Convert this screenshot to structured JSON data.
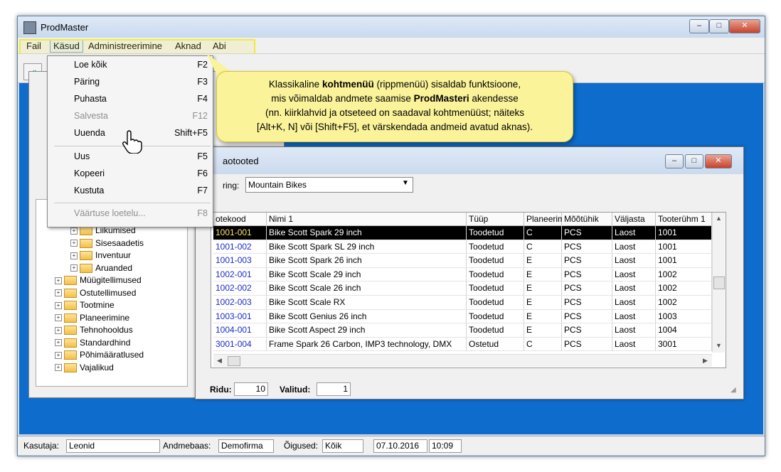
{
  "window": {
    "title": "ProdMaster",
    "controls": [
      "–",
      "□",
      "✕"
    ]
  },
  "menubar": {
    "items": [
      "Fail",
      "Käsud",
      "Administreerimine",
      "Aknad",
      "Abi"
    ]
  },
  "dropdown": {
    "items": [
      {
        "label": "Loe kõik",
        "key": "F2",
        "enabled": true
      },
      {
        "label": "Päring",
        "key": "F3",
        "enabled": true
      },
      {
        "label": "Puhasta",
        "key": "F4",
        "enabled": true
      },
      {
        "label": "Salvesta",
        "key": "F12",
        "enabled": false
      },
      {
        "label": "Uuenda",
        "key": "Shift+F5",
        "enabled": true
      },
      {
        "label": "Uus",
        "key": "F5",
        "enabled": true
      },
      {
        "label": "Kopeeri",
        "key": "F6",
        "enabled": true
      },
      {
        "label": "Kustuta",
        "key": "F7",
        "enabled": true
      },
      {
        "label": "Väärtuse loetelu...",
        "key": "F8",
        "enabled": false
      }
    ]
  },
  "callout": {
    "line1_pre": "Klassikaline ",
    "line1_bold": "kohtmenüü",
    "line1_post": " (rippmenüü) sisaldab funktsioone,",
    "line2_pre": "mis võimaldab andmete saamise ",
    "line2_bold": "ProdMasteri",
    "line2_post": " akendesse",
    "line3": "(nn. kiirklahvid ja otseteed on saadaval kohtmenüüst; näiteks",
    "line4": "[Alt+K, N] või [Shift+F5], et värskendada andmeid avatud aknas)."
  },
  "tree": {
    "items": [
      {
        "label": "Liikumised",
        "level": 1
      },
      {
        "label": "Sisesaadetis",
        "level": 1
      },
      {
        "label": "Inventuur",
        "level": 1
      },
      {
        "label": "Aruanded",
        "level": 1
      },
      {
        "label": "Müügitellimused",
        "level": 0
      },
      {
        "label": "Ostutellimused",
        "level": 0
      },
      {
        "label": "Tootmine",
        "level": 0
      },
      {
        "label": "Planeerimine",
        "level": 0
      },
      {
        "label": "Tehnohooldus",
        "level": 0
      },
      {
        "label": "Standardhind",
        "level": 0
      },
      {
        "label": "Põhimääratlused",
        "level": 0
      },
      {
        "label": "Vajalikud",
        "level": 0
      }
    ]
  },
  "products": {
    "title": "aotooted",
    "filter_label": "ring:",
    "filter_value": "Mountain Bikes",
    "columns": [
      "otekood",
      "Nimi 1",
      "Tüüp",
      "Planeerim",
      "Mõõtühik",
      "Väljasta",
      "Tooterühm 1"
    ],
    "rows": [
      [
        "1001-001",
        "Bike Scott Spark 29 inch",
        "Toodetud",
        "C",
        "PCS",
        "Laost",
        "1001"
      ],
      [
        "1001-002",
        "Bike Scott Spark SL 29 inch",
        "Toodetud",
        "C",
        "PCS",
        "Laost",
        "1001"
      ],
      [
        "1001-003",
        "Bike Scott Spark 26 inch",
        "Toodetud",
        "E",
        "PCS",
        "Laost",
        "1001"
      ],
      [
        "1002-001",
        "Bike Scott Scale 29 inch",
        "Toodetud",
        "E",
        "PCS",
        "Laost",
        "1002"
      ],
      [
        "1002-002",
        "Bike Scott Scale 26 inch",
        "Toodetud",
        "E",
        "PCS",
        "Laost",
        "1002"
      ],
      [
        "1002-003",
        "Bike Scott Scale RX",
        "Toodetud",
        "E",
        "PCS",
        "Laost",
        "1002"
      ],
      [
        "1003-001",
        "Bike Scott Genius 26 inch",
        "Toodetud",
        "E",
        "PCS",
        "Laost",
        "1003"
      ],
      [
        "1004-001",
        "Bike Scott Aspect 29 inch",
        "Toodetud",
        "E",
        "PCS",
        "Laost",
        "1004"
      ],
      [
        "3001-004",
        "Frame Spark 26 Carbon, IMP3 technology, DMX",
        "Ostetud",
        "C",
        "PCS",
        "Laost",
        "3001"
      ]
    ],
    "rows_label": "Ridu:",
    "rows_value": "10",
    "selected_label": "Valitud:",
    "selected_value": "1"
  },
  "status": {
    "user_label": "Kasutaja:",
    "user": "Leonid",
    "db_label": "Andmebaas:",
    "db": "Demofirma",
    "rights_label": "Õigused:",
    "rights": "Kõik",
    "date": "07.10.2016",
    "time": "10:09"
  }
}
